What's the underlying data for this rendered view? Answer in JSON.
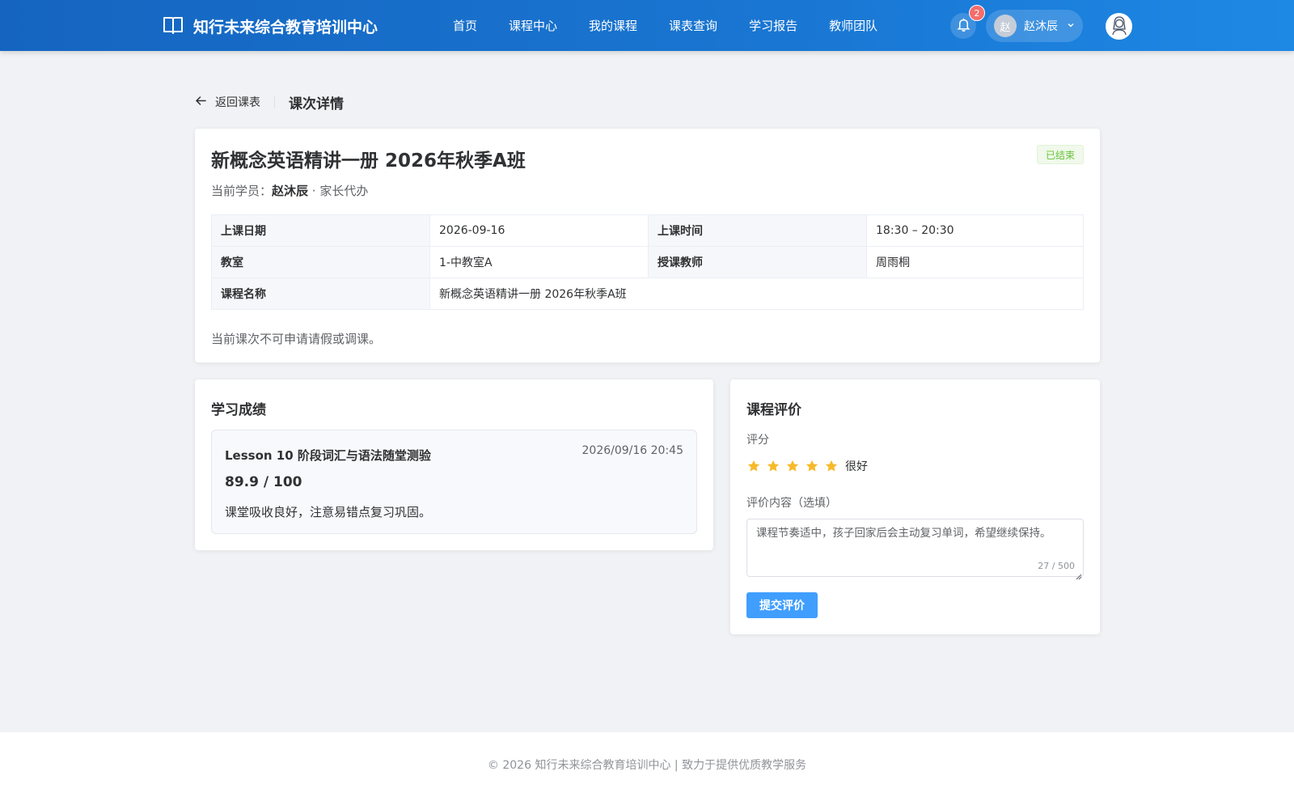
{
  "header": {
    "brand": "知行未来综合教育培训中心",
    "nav": [
      "首页",
      "课程中心",
      "我的课程",
      "课表查询",
      "学习报告",
      "教师团队"
    ],
    "notification_count": "2",
    "user_initial": "赵",
    "user_name": "赵沐辰"
  },
  "breadcrumb": {
    "back_label": "返回课表",
    "page_title": "课次详情"
  },
  "lesson": {
    "title": "新概念英语精讲一册 2026年秋季A班",
    "status": "已结束",
    "student_prefix": "当前学员：",
    "student_name": "赵沐辰",
    "student_suffix": " · 家长代办",
    "info": {
      "date_label": "上课日期",
      "date": "2026-09-16",
      "time_label": "上课时间",
      "time": "18:30 – 20:30",
      "room_label": "教室",
      "room": "1-中教室A",
      "teacher_label": "授课教师",
      "teacher": "周雨桐",
      "course_label": "课程名称",
      "course": "新概念英语精讲一册 2026年秋季A班"
    },
    "note": "当前课次不可申请请假或调课。"
  },
  "score": {
    "heading": "学习成绩",
    "test_name": "Lesson 10 阶段词汇与语法随堂测验",
    "test_time": "2026/09/16 20:45",
    "value": "89.9 / 100",
    "comment": "课堂吸收良好，注意易错点复习巩固。"
  },
  "evaluation": {
    "heading": "课程评价",
    "rating_label": "评分",
    "rating": 5,
    "rating_max": 5,
    "rating_text": "很好",
    "content_label": "评价内容（选填）",
    "content": "课程节奏适中，孩子回家后会主动复习单词，希望继续保持。",
    "counter": "27 / 500",
    "submit_label": "提交评价",
    "star_color": "#f7ba2a"
  },
  "footer": {
    "text": "© 2026 知行未来综合教育培训中心 | 致力于提供优质教学服务"
  }
}
